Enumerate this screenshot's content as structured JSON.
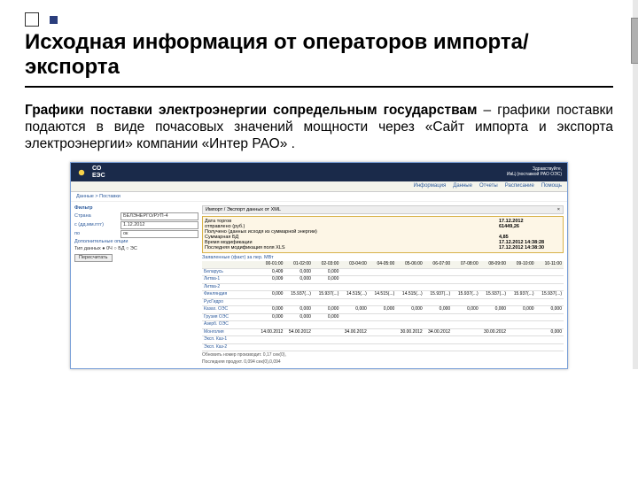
{
  "bullet": "",
  "title": "Исходная информация от операторов импорта/экспорта",
  "para_bold": "Графики поставки электроэнергии сопредельным государствам",
  "para_rest": " – графики поставки подаются в виде почасовых значений мощности через «Сайт импорта и экспорта электроэнергии» компании «Интер РАО» .",
  "brand": "СО\nЕЭС",
  "user": "Здравствуйте,\nИвЦ (поставкой РАО ОЭС)",
  "nav": [
    "Информация",
    "Данные",
    "Отчеты",
    "Расписание",
    "Помощь"
  ],
  "crumb": "Данные > Поставки",
  "left_title": "Фильтр",
  "form": {
    "f1_lbl": "Страна",
    "f1_v": "БЕЛЭНЕРГО/РУП-4",
    "f2_lbl": "с (дд.мм.гггг)",
    "f2_v": "1.12.2012",
    "f3_lbl": "по",
    "f3_v": "ок",
    "f4_lbl": "",
    "f4_v": "Дополнительные опции",
    "f5": "Тип данных   ● 0Ч  ○ БД  ○ ЭС"
  },
  "btn": "Пересчитать",
  "right_title": "Импорт / Экспорт данных от XML",
  "info": {
    "r1": "Дата торгов",
    "v1": "17.12.2012",
    "r2": "отправлено (руб.)",
    "v2": "61449,26",
    "r3": "Получено (данных исходя из суммарной энергии)",
    "v3": "",
    "r4": "Суммарная БД",
    "v4": "4,85",
    "r5": "Время модификации",
    "v5": "17.12.2012 14:38:28",
    "r6": "Последняя модификация поля XLS",
    "v6": "17.12.2012 14:38:30"
  },
  "tbl_title": "Заявленные (факт) за пер. МВт",
  "headers": [
    "",
    "00-01:00",
    "01-02:00",
    "02-03:00",
    "03-04:00",
    "04-05:00",
    "05-06:00",
    "06-07:00",
    "07-08:00",
    "08-09:00",
    "09-10:00",
    "10-11:00"
  ],
  "rows": [
    [
      "Беларусь",
      "0,409",
      "0,000",
      "0,000",
      "",
      "",
      "",
      "",
      "",
      "",
      "",
      ""
    ],
    [
      "Литва-1",
      "0,009",
      "0,000",
      "0,000",
      "",
      "",
      "",
      "",
      "",
      "",
      "",
      ""
    ],
    [
      "Литва-2",
      "",
      "",
      "",
      "",
      "",
      "",
      "",
      "",
      "",
      "",
      ""
    ],
    [
      "Финляндия",
      "0,000",
      "15.937(...)",
      "15.937(...)",
      "14.515(...)",
      "14.515(...)",
      "14.515(...)",
      "15.937(...)",
      "15.937(...)",
      "15.937(...)",
      "15.937(...)",
      "15.937(...)"
    ],
    [
      "РусГидро",
      "",
      "",
      "",
      "",
      "",
      "",
      "",
      "",
      "",
      "",
      ""
    ],
    [
      "Казах. ОЭС",
      "0,000",
      "0,000",
      "0,000",
      "0,000",
      "0,000",
      "0,000",
      "0,000",
      "0,000",
      "0,000",
      "0,000",
      "0,000"
    ],
    [
      "Грузия ОЭС",
      "0,000",
      "0,000",
      "0,000",
      "",
      "",
      "",
      "",
      "",
      "",
      "",
      ""
    ],
    [
      "Азерб. ОЭС",
      "",
      "",
      "",
      "",
      "",
      "",
      "",
      "",
      "",
      "",
      ""
    ],
    [
      "Монголия",
      "14.00.2012",
      "54.00.2012",
      "",
      "34.00.2012",
      "",
      "30.00.2012",
      "34.00.2012",
      "",
      "30.00.2012",
      "",
      "0,000"
    ],
    [
      "Эксп. Каз-1",
      "",
      "",
      "",
      "",
      "",
      "",
      "",
      "",
      "",
      "",
      ""
    ],
    [
      "Эксп. Каз-2",
      "",
      "",
      "",
      "",
      "",
      "",
      "",
      "",
      "",
      "",
      ""
    ]
  ],
  "hint1": "Обновить номер производит. 0,17 сек(0),",
  "hint2": "Последняя продукт. 0,094 сек(0),0,094"
}
